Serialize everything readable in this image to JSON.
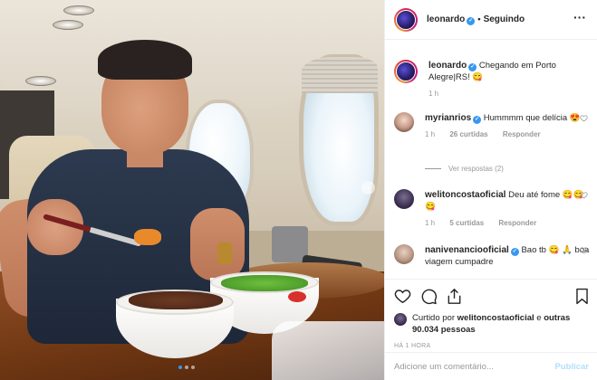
{
  "post": {
    "image_description_icon": "photo-content",
    "carousel": {
      "next_icon": "chevron-right-icon",
      "page_count": 3,
      "active_index": 0
    }
  },
  "header": {
    "username": "leonardo",
    "verified": true,
    "separator": "•",
    "follow_status": "Seguindo",
    "more_icon": "ellipsis-icon"
  },
  "caption": {
    "username": "leonardo",
    "text": "Chegando em Porto Alegre|RS! 😋",
    "time": "1 h"
  },
  "comments": [
    {
      "username": "myrianrios",
      "verified": true,
      "text": "Hummmm que delícia 😍",
      "time": "1 h",
      "likes": "26 curtidas",
      "reply_label": "Responder",
      "view_replies": "Ver respostas (2)"
    },
    {
      "username": "welitoncostaoficial",
      "verified": false,
      "text": "Deu até fome 😋😋😋",
      "time": "1 h",
      "likes": "5 curtidas",
      "reply_label": "Responder"
    },
    {
      "username": "nanivenanciooficial",
      "verified": true,
      "text": "Bao tb 😋 🙏 boa viagem cumpadre"
    }
  ],
  "actions": {
    "like_icon": "heart-icon",
    "comment_icon": "comment-icon",
    "share_icon": "share-icon",
    "save_icon": "bookmark-icon"
  },
  "likes": {
    "prefix": "Curtido por ",
    "user": "welitoncostaoficial",
    "middle": " e ",
    "others": "outras 90.034 pessoas"
  },
  "timestamp": "HÁ 1 HORA",
  "add_comment": {
    "placeholder": "Adicione um comentário...",
    "publish_label": "Publicar"
  },
  "colors": {
    "accent": "#3897f0",
    "publish_disabled": "#b2dffc",
    "muted": "#999999",
    "text": "#262626"
  }
}
